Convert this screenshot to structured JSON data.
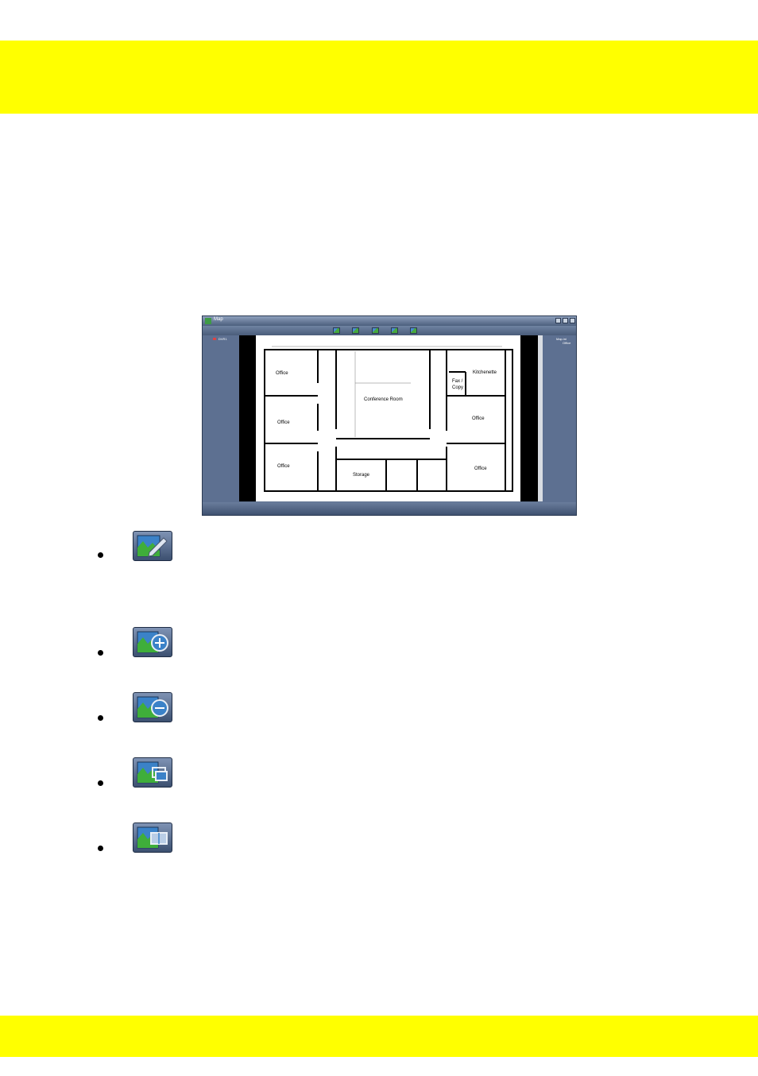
{
  "window": {
    "title": "Map",
    "tree_root": "DVR1",
    "right_tree": [
      "Map.ini",
      "Office"
    ]
  },
  "floor_plan": {
    "rooms": [
      "Office",
      "Office",
      "Office",
      "Conference Room",
      "Storage",
      "Kitchenette",
      "Fax /",
      "Copy",
      "Office",
      "Office"
    ]
  },
  "toolbar_icons": [
    "edit-map-icon",
    "zoom-in-map-icon",
    "zoom-out-map-icon",
    "fit-window-icon",
    "original-size-icon"
  ],
  "colors": {
    "band": "#ffff00",
    "window_bg": "#5e7190",
    "icon_green": "#3fae3a",
    "icon_blue": "#3b82c8"
  }
}
